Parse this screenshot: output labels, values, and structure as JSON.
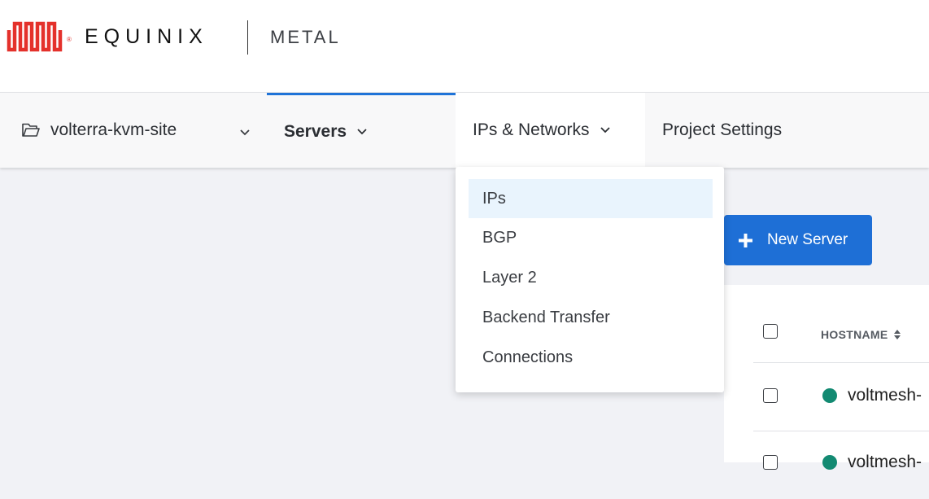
{
  "brand": {
    "company": "EQUINIX",
    "product": "METAL",
    "logo_color": "#e4312b",
    "registered_mark": "®"
  },
  "nav": {
    "project_name": "volterra-kvm-site",
    "servers_label": "Servers",
    "ips_networks_label": "IPs & Networks",
    "project_settings_label": "Project Settings",
    "active_tab": "Servers",
    "accent_color": "#1f73d8"
  },
  "dropdown": {
    "items": [
      {
        "label": "IPs",
        "highlighted": true
      },
      {
        "label": "BGP"
      },
      {
        "label": "Layer 2"
      },
      {
        "label": "Backend Transfer"
      },
      {
        "label": "Connections"
      }
    ]
  },
  "actions": {
    "new_server_label": "New Server",
    "button_color": "#1e6fd6"
  },
  "table": {
    "columns": [
      "HOSTNAME"
    ],
    "rows": [
      {
        "hostname": "voltmesh-",
        "status_color": "#138a72"
      },
      {
        "hostname": "voltmesh-",
        "status_color": "#138a72"
      }
    ]
  }
}
